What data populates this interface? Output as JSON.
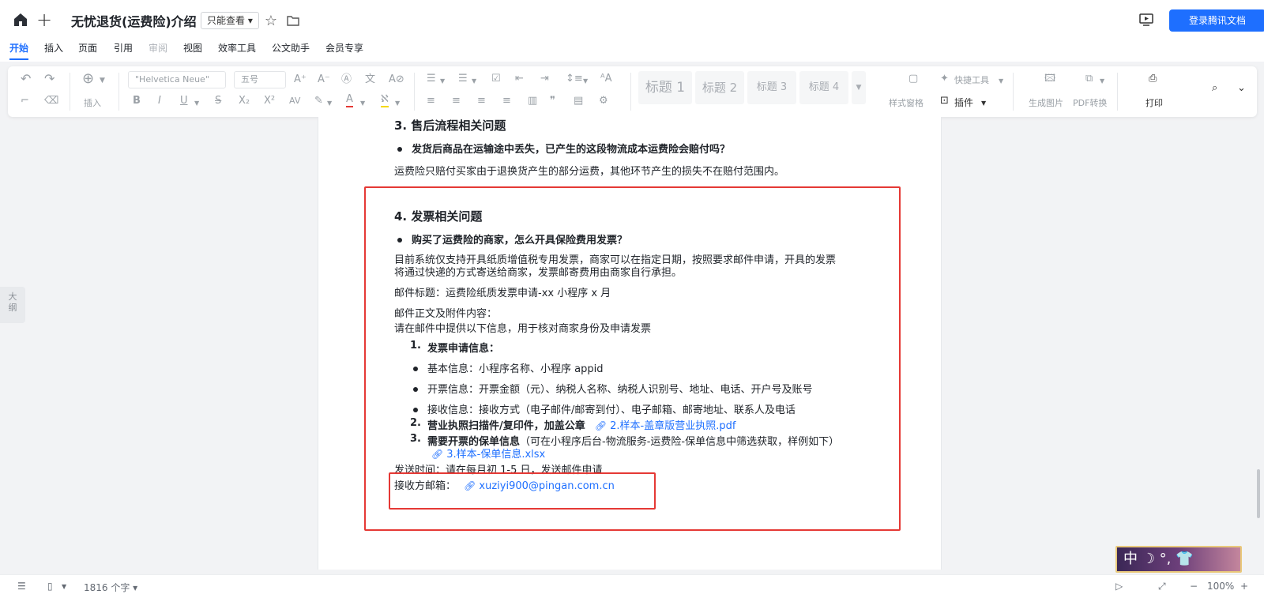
{
  "titlebar": {
    "title": "无忧退货(运费险)介绍",
    "mode": "只能查看 ▾",
    "login_label": "登录腾讯文档"
  },
  "menu": {
    "tabs": [
      "开始",
      "插入",
      "页面",
      "引用",
      "审阅",
      "视图",
      "效率工具",
      "公文助手",
      "会员专享"
    ],
    "active": "开始"
  },
  "toolbar": {
    "insert_label": "插入",
    "font_family": "\"Helvetica Neue\"",
    "font_size": "五号",
    "headings": [
      "标题 1",
      "标题 2",
      "标题 3",
      "标题 4"
    ],
    "style_pane": "样式窗格",
    "quick_tools": "快捷工具",
    "plugin": "插件",
    "gen_image": "生成图片",
    "pdf_convert": "PDF转换",
    "print": "打印"
  },
  "outline_label": "大纲",
  "doc": {
    "s3_heading": "3.  售后流程相关问题",
    "s3_question": "发货后商品在运输途中丢失，已产生的这段物流成本运费险会赔付吗？",
    "s3_answer": "运费险只赔付买家由于退换货产生的部分运费，其他环节产生的损失不在赔付范围内。",
    "s4_heading": "4.  发票相关问题",
    "s4_question": "购买了运费险的商家，怎么开具保险费用发票？",
    "s4_p1_line1": "目前系统仅支持开具纸质增值税专用发票，商家可以在指定日期，按照要求邮件申请，开具的发票",
    "s4_p1_line2": "将通过快递的方式寄送给商家，发票邮寄费用由商家自行承担。",
    "mail_subject": "邮件标题：运费险纸质发票申请-xx 小程序 x 月",
    "mail_body_title": "邮件正文及附件内容：",
    "mail_body_desc": "请在邮件中提供以下信息，用于核对商家身份及申请发票",
    "item1_num": "1.",
    "item1": "发票申请信息：",
    "bullet1": "基本信息：小程序名称、小程序 appid",
    "bullet2": "开票信息：开票金额（元）、纳税人名称、纳税人识别号、地址、电话、开户号及账号",
    "bullet3": "接收信息：接收方式（电子邮件/邮寄到付）、电子邮箱、邮寄地址、联系人及电话",
    "item2_num": "2.",
    "item2": "营业执照扫描件/复印件，加盖公章",
    "item2_link": "2.样本-盖章版营业执照.pdf",
    "item3_num": "3.",
    "item3_bold": "需要开票的保单信息",
    "item3_rest": "（可在小程序后台-物流服务-运费险-保单信息中筛选获取，样例如下）",
    "item3_link": "3.样本-保单信息.xlsx",
    "send_time": "发送时间：请在每月初 1-5 日，发送邮件申请",
    "recv_label": "接收方邮箱：",
    "recv_email": "xuziyi900@pingan.com.cn"
  },
  "status": {
    "word_count": "1816 个字 ▾",
    "zoom": "100%"
  },
  "ime": {
    "text": "中 ☽ °, 👕"
  },
  "colors": {
    "accent": "#1e6fff",
    "highlight_box": "#e53935"
  }
}
